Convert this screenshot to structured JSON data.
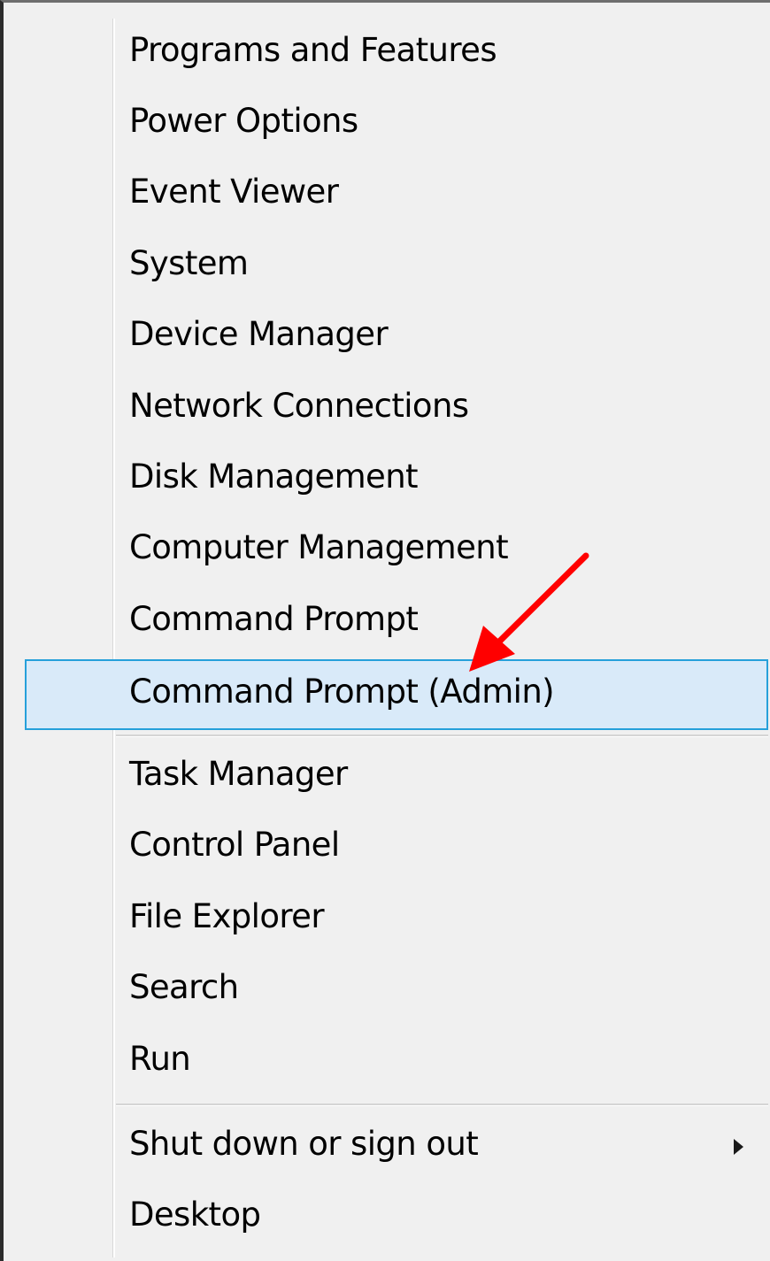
{
  "menu": {
    "group1": [
      {
        "name": "menu-item-programs-and-features",
        "label": "Programs and Features"
      },
      {
        "name": "menu-item-power-options",
        "label": "Power Options"
      },
      {
        "name": "menu-item-event-viewer",
        "label": "Event Viewer"
      },
      {
        "name": "menu-item-system",
        "label": "System"
      },
      {
        "name": "menu-item-device-manager",
        "label": "Device Manager"
      },
      {
        "name": "menu-item-network-connections",
        "label": "Network Connections"
      },
      {
        "name": "menu-item-disk-management",
        "label": "Disk Management"
      },
      {
        "name": "menu-item-computer-management",
        "label": "Computer Management"
      },
      {
        "name": "menu-item-command-prompt",
        "label": "Command Prompt"
      },
      {
        "name": "menu-item-command-prompt-admin",
        "label": "Command Prompt (Admin)",
        "highlighted": true
      }
    ],
    "group2": [
      {
        "name": "menu-item-task-manager",
        "label": "Task Manager"
      },
      {
        "name": "menu-item-control-panel",
        "label": "Control Panel"
      },
      {
        "name": "menu-item-file-explorer",
        "label": "File Explorer"
      },
      {
        "name": "menu-item-search",
        "label": "Search"
      },
      {
        "name": "menu-item-run",
        "label": "Run"
      }
    ],
    "group3": [
      {
        "name": "menu-item-shut-down",
        "label": "Shut down or sign out",
        "has_submenu": true,
        "submenu_icon": "chevron-right-icon"
      },
      {
        "name": "menu-item-desktop",
        "label": "Desktop"
      }
    ]
  },
  "colors": {
    "menu_background": "#f0f0f0",
    "highlight_background": "#d9eaf9",
    "highlight_border": "#26a0da",
    "annotation_arrow": "#ff0000"
  },
  "annotation": {
    "icon": "red-arrow-icon",
    "points_to": "menu-item-command-prompt-admin"
  }
}
